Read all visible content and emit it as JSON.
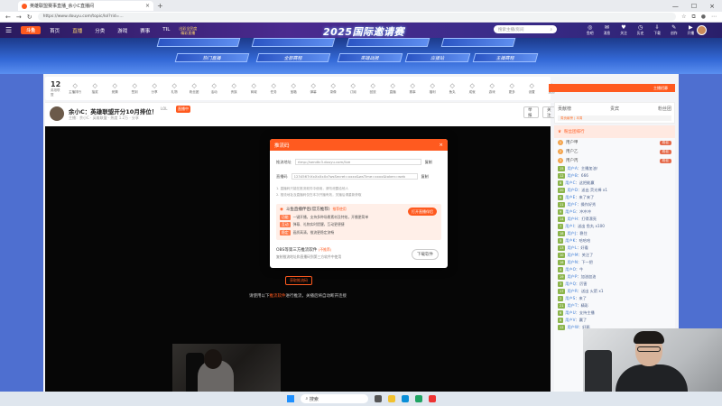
{
  "browser": {
    "tab_title": "英雄联盟赛事直播_余小C直播间",
    "url": "https://www.douyu.com/topic/lol?rid=..."
  },
  "header": {
    "logo": "斗鱼",
    "nav": [
      "首页",
      "直播",
      "分类",
      "游戏",
      "赛事",
      "TIL"
    ],
    "promo_line1": "出彩全民度",
    "promo_line2": "精彩直播",
    "banner_title": "2025国际邀请赛",
    "search_placeholder": "搜索主播/房间",
    "icons": [
      "鱼吧",
      "消息",
      "关注",
      "历史",
      "下载",
      "创作",
      "开播"
    ]
  },
  "event": {
    "buttons_top": [
      "",
      "",
      "",
      "",
      ""
    ],
    "buttons_row": [
      "热门直播",
      "全部赛程",
      "英雄战报",
      "应援站",
      "主播赛程"
    ]
  },
  "toolbar": {
    "count": "12",
    "count_label": "英雄联盟",
    "items": [
      "主播排行",
      "抽奖",
      "竞猜",
      "签到",
      "分享",
      "礼物",
      "粉丝团",
      "活动",
      "贵族",
      "商城",
      "任务",
      "宝箱",
      "弹幕",
      "录像",
      "订阅",
      "回放",
      "直播",
      "赛事",
      "福利",
      "鱼丸",
      "成就",
      "游戏",
      "更多",
      "设置",
      "反馈"
    ],
    "right_label": "主播招募"
  },
  "streamer": {
    "title": "余小C：英雄联盟开分10月排位！",
    "tag": "LOL",
    "tag2": "直播中",
    "meta": "主播：余小C  · 英雄联盟 · 热度 1.2万 · 分享",
    "btn_follow": "关注",
    "btn_report": "举报"
  },
  "rank": {
    "tabs": [
      "贡献榜",
      "贵宾",
      "粉丝团"
    ],
    "bar": "周贡献榜 | 本周"
  },
  "chat": {
    "head": "粉丝团排行",
    "fans": [
      {
        "rank": "1",
        "name": "用户甲",
        "badge": "粉丝"
      },
      {
        "rank": "2",
        "name": "用户乙",
        "badge": "粉丝"
      },
      {
        "rank": "3",
        "name": "用户丙",
        "badge": "粉丝"
      }
    ],
    "messages": [
      {
        "lv": "15",
        "name": "用户A",
        "text": "主播加油！"
      },
      {
        "lv": "12",
        "name": "用户B",
        "text": "666"
      },
      {
        "lv": "8",
        "name": "用户C",
        "text": "这把能赢"
      },
      {
        "lv": "20",
        "name": "用户D",
        "text": "送出 荧光棒 x1"
      },
      {
        "lv": "6",
        "name": "用户E",
        "text": "来了来了"
      },
      {
        "lv": "11",
        "name": "用户F",
        "text": "操作好秀"
      },
      {
        "lv": "9",
        "name": "用户G",
        "text": "冲冲冲"
      },
      {
        "lv": "14",
        "name": "用户H",
        "text": "打得漂亮"
      },
      {
        "lv": "7",
        "name": "用户I",
        "text": "送出 鱼丸 x100"
      },
      {
        "lv": "18",
        "name": "用户J",
        "text": "稳住"
      },
      {
        "lv": "5",
        "name": "用户K",
        "text": "哈哈哈"
      },
      {
        "lv": "13",
        "name": "用户L",
        "text": "好看"
      },
      {
        "lv": "10",
        "name": "用户M",
        "text": "关注了"
      },
      {
        "lv": "16",
        "name": "用户N",
        "text": "下一把"
      },
      {
        "lv": "4",
        "name": "用户O",
        "text": "牛"
      },
      {
        "lv": "19",
        "name": "用户P",
        "text": "加油加油"
      },
      {
        "lv": "3",
        "name": "用户Q",
        "text": "厉害"
      },
      {
        "lv": "17",
        "name": "用户R",
        "text": "送出 火箭 x1"
      },
      {
        "lv": "2",
        "name": "用户S",
        "text": "来了"
      },
      {
        "lv": "21",
        "name": "用户T",
        "text": "精彩"
      },
      {
        "lv": "6",
        "name": "用户U",
        "text": "支持主播"
      },
      {
        "lv": "8",
        "name": "用户V",
        "text": "赢了"
      },
      {
        "lv": "12",
        "name": "用户W",
        "text": "好耶"
      }
    ]
  },
  "modal": {
    "title": "推流码",
    "label_server": "推流地址",
    "server_value": "rtmp://sendtc3.douyu.com/live",
    "copy": "复制",
    "label_key": "直播码",
    "key_value": "1234567rXxXxXxXx?wsSecret=xxxx&wsTime=xxxx&token=web",
    "note1": "1. 直播码只能在推流软件中使用，请勿泄露给他人",
    "note2": "2. 推流地址及直播码仅在本次开播有效，关播后请重新获取",
    "card_title": "斗鱼直播伴侣(官方推荐)",
    "card_rec": "推荐使用",
    "card_btn": "打开直播伴侣",
    "card_lines": [
      {
        "tag": "功能",
        "text": "一键开播，支持多种场景素材及特效，开播更简单"
      },
      {
        "tag": "互动",
        "text": "弹幕、礼物实时提醒，互动更便捷"
      },
      {
        "tag": "稳定",
        "text": "画质高清，推流更稳定流畅"
      }
    ],
    "obs_title": "OBS等第三方推流软件",
    "obs_tag": "(不推荐)",
    "obs_sub": "复制推流地址和直播码到第三方软件中使用",
    "download": "下载软件"
  },
  "below": {
    "button": "获取推流码",
    "text_pre": "请使用以下",
    "text_hl": "推流软件",
    "text_post": "进行推流，关播后将自动断开连接"
  },
  "taskbar": {
    "search": "搜索"
  }
}
